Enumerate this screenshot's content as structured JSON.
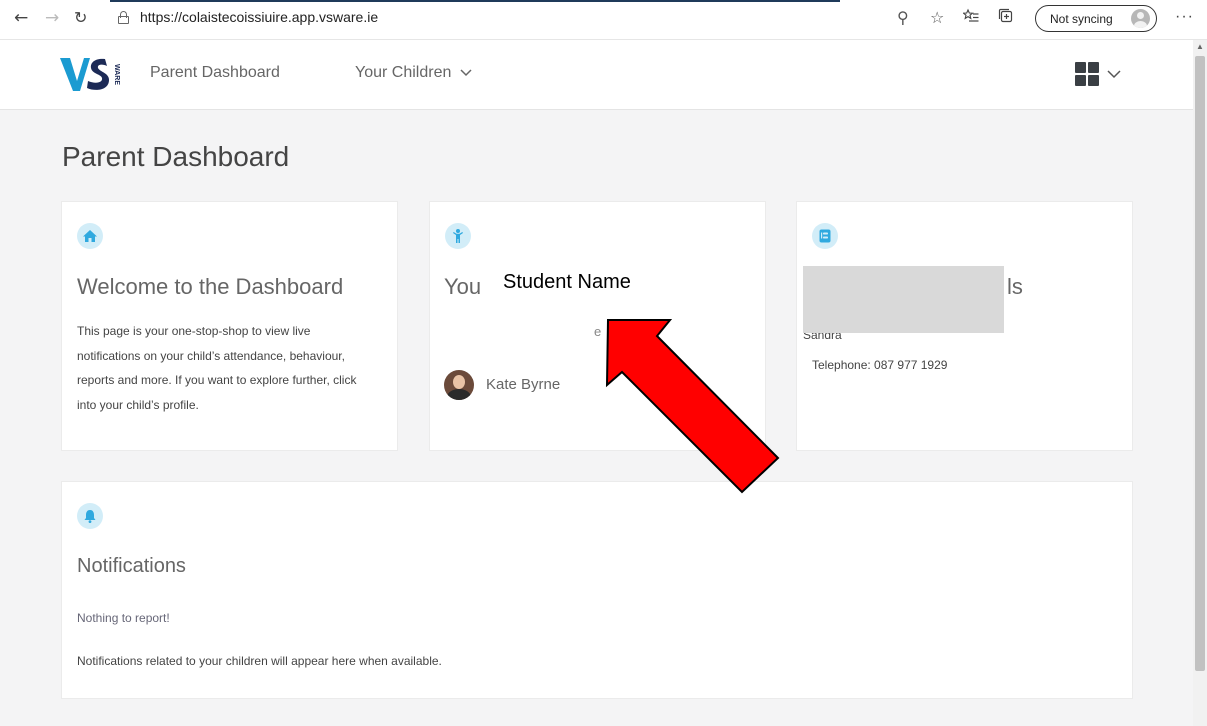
{
  "browser": {
    "back_glyph": "←",
    "forward_glyph": "→",
    "reload_glyph": "↻",
    "url_scheme": "https://",
    "url_host": "colaistecoissiuire.app.vsware.ie",
    "icons": [
      "key-icon",
      "star-icon",
      "favorites-icon",
      "collections-icon"
    ],
    "key_glyph": "⚲",
    "star_glyph": "☆",
    "fav_glyph": "⭐",
    "coll_glyph": "⧉",
    "sync_label": "Not syncing",
    "more_glyph": "···"
  },
  "header": {
    "brand": "VSware",
    "nav": {
      "dashboard": "Parent Dashboard",
      "children": "Your Children",
      "chevron": "⌄"
    },
    "apps_chevron": "⌄"
  },
  "page": {
    "title": "Parent Dashboard"
  },
  "cards": {
    "welcome": {
      "icon": "home-icon",
      "title": "Welcome to the Dashboard",
      "body": "This page is your one-stop-shop to view live notifications on your child’s attendance, behaviour, reports and more. If you want to explore further, click into your child’s profile."
    },
    "children": {
      "icon": "child-icon",
      "title_prefix": "You",
      "overlay_label": "Student Name",
      "partial_char": "e",
      "child_name": "Kate Byrne"
    },
    "contact": {
      "icon": "contact-book-icon",
      "title_tail": "ls",
      "partial_name": "Sandra",
      "telephone": "Telephone: 087 977 1929"
    },
    "notifications": {
      "icon": "bell-icon",
      "title": "Notifications",
      "empty": "Nothing to report!",
      "description": "Notifications related to your children will appear here when available."
    }
  },
  "colors": {
    "accent_light": "#d2edf8",
    "accent": "#2fa9df",
    "logo_teal": "#1b9bd1",
    "logo_navy": "#1c2a56",
    "annotation_red": "#ff0000"
  }
}
